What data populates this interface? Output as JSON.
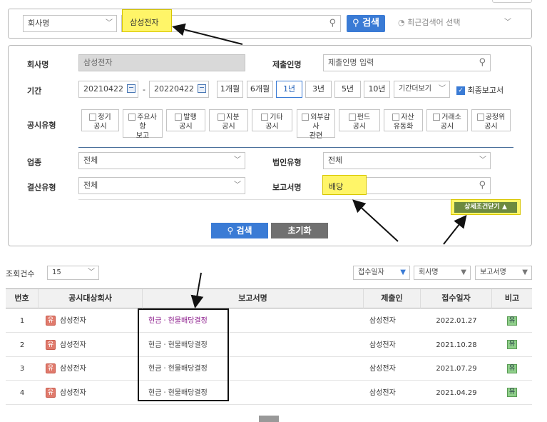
{
  "search": {
    "category": "회사명",
    "query": "삼성전자",
    "button": "검색",
    "recent": "최근검색어 선택"
  },
  "filters": {
    "company_label": "회사명",
    "company_value": "삼성전자",
    "submitter_label": "제출인명",
    "submitter_placeholder": "제출인명 입력",
    "period_label": "기간",
    "date_from": "20210422",
    "date_to": "20220422",
    "date_sep": "-",
    "period_buttons": [
      "1개월",
      "6개월",
      "1년",
      "3년",
      "5년",
      "10년"
    ],
    "period_more": "기간더보기",
    "latest_report": "최종보고서",
    "type_label": "공시유형",
    "types": [
      {
        "l1": "정기",
        "l2": "공시"
      },
      {
        "l1": "주요사",
        "l2": "항",
        "l3": "보고"
      },
      {
        "l1": "발행",
        "l2": "공시"
      },
      {
        "l1": "지분",
        "l2": "공시"
      },
      {
        "l1": "기타",
        "l2": "공시"
      },
      {
        "l1": "외부감",
        "l2": "사",
        "l3": "관련"
      },
      {
        "l1": "펀드",
        "l2": "공시"
      },
      {
        "l1": "자산",
        "l2": "유동화"
      },
      {
        "l1": "거래소",
        "l2": "공시"
      },
      {
        "l1": "공정위",
        "l2": "공시"
      }
    ],
    "industry_label": "업종",
    "industry_value": "전체",
    "corp_type_label": "법인유형",
    "corp_type_value": "전체",
    "settle_label": "결산유형",
    "settle_value": "전체",
    "report_label": "보고서명",
    "report_value": "배당",
    "detail_toggle": "상세조건닫기 ▲",
    "search_btn": "검색",
    "reset_btn": "초기화"
  },
  "results": {
    "count_label": "조회건수",
    "count_value": "15",
    "sort1": "접수일자",
    "sort2": "회사명",
    "sort3": "보고서명",
    "headers": [
      "번호",
      "공시대상회사",
      "보고서명",
      "제출인",
      "접수일자",
      "비고"
    ],
    "corp_badge": "유",
    "note_badge": "유",
    "rows": [
      {
        "no": "1",
        "company": "삼성전자",
        "report": "현금ㆍ현물배당결정",
        "submitter": "삼성전자",
        "date": "2022.01.27"
      },
      {
        "no": "2",
        "company": "삼성전자",
        "report": "현금ㆍ현물배당결정",
        "submitter": "삼성전자",
        "date": "2021.10.28"
      },
      {
        "no": "3",
        "company": "삼성전자",
        "report": "현금ㆍ현물배당결정",
        "submitter": "삼성전자",
        "date": "2021.07.29"
      },
      {
        "no": "4",
        "company": "삼성전자",
        "report": "현금ㆍ현물배당결정",
        "submitter": "삼성전자",
        "date": "2021.04.29"
      }
    ]
  }
}
